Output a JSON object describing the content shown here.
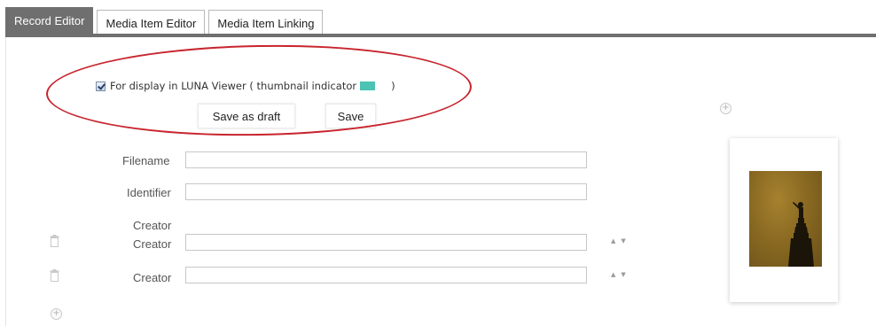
{
  "tabs": [
    {
      "label": "Record Editor",
      "active": true
    },
    {
      "label": "Media Item Editor",
      "active": false
    },
    {
      "label": "Media Item Linking",
      "active": false
    }
  ],
  "display": {
    "checked": true,
    "label": "For display in LUNA Viewer ( thumbnail indicator",
    "label_close": ")",
    "indicator_color": "#4cc3b3"
  },
  "buttons": {
    "save_draft": "Save as draft",
    "save": "Save"
  },
  "form": {
    "filename": {
      "label": "Filename",
      "value": ""
    },
    "identifier": {
      "label": "Identifier",
      "value": ""
    },
    "creator_group_label": "Creator",
    "creators": [
      {
        "label": "Creator",
        "value": ""
      },
      {
        "label": "Creator",
        "value": ""
      }
    ]
  },
  "annotation": {
    "color": "#c8242e",
    "shape": "ellipse"
  },
  "colors": {
    "tab_active_bg": "#6f6f6f",
    "tab_active_text": "#ffffff"
  },
  "icons": {
    "add": "plus-circle-icon",
    "delete": "trash-icon",
    "move_up": "triangle-up-icon",
    "move_down": "triangle-down-icon"
  }
}
